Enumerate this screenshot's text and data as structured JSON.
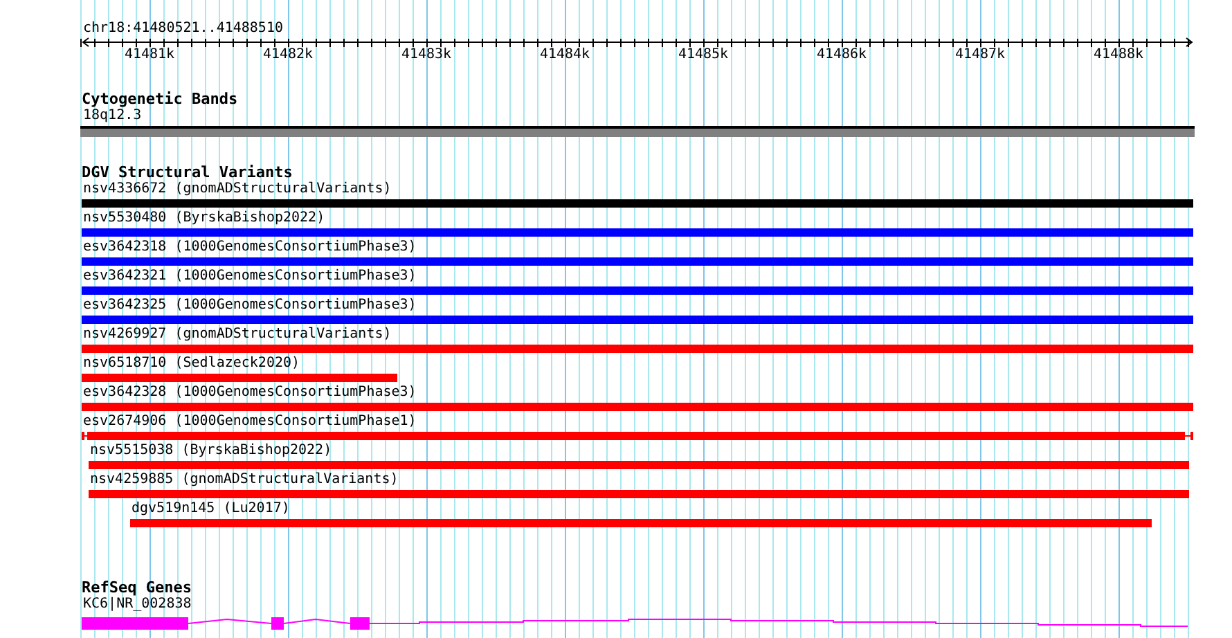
{
  "location": "chr18:41480521..41488510",
  "ruler": {
    "ticks": [
      "41481k",
      "41482k",
      "41483k",
      "41484k",
      "41485k",
      "41486k",
      "41487k",
      "41488k"
    ]
  },
  "cytobands": {
    "title": "Cytogenetic Bands",
    "band": "18q12.3"
  },
  "variants": {
    "title": "DGV Structural Variants",
    "features": [
      {
        "label": "nsv4336672 (gnomADStructuralVariants)",
        "color": "#000000"
      },
      {
        "label": "nsv5530480 (ByrskaBishop2022)",
        "color": "#0000ff"
      },
      {
        "label": "esv3642318 (1000GenomesConsortiumPhase3)",
        "color": "#0000ff"
      },
      {
        "label": "esv3642321 (1000GenomesConsortiumPhase3)",
        "color": "#0000ff"
      },
      {
        "label": "esv3642325 (1000GenomesConsortiumPhase3)",
        "color": "#0000ff"
      },
      {
        "label": "nsv4269927 (gnomADStructuralVariants)",
        "color": "#ff0000"
      },
      {
        "label": "nsv6518710 (Sedlazeck2020)",
        "color": "#ff0000"
      },
      {
        "label": "esv3642328 (1000GenomesConsortiumPhase3)",
        "color": "#ff0000"
      },
      {
        "label": "esv2674906 (1000GenomesConsortiumPhase1)",
        "color": "#ff0000"
      },
      {
        "label": "nsv5515038 (ByrskaBishop2022)",
        "color": "#ff0000"
      },
      {
        "label": "nsv4259885 (gnomADStructuralVariants)",
        "color": "#ff0000"
      },
      {
        "label": "dgv519n145 (Lu2017)",
        "color": "#ff0000"
      }
    ]
  },
  "genes": {
    "title": "RefSeq Genes",
    "label": "KC6|NR_002838"
  }
}
